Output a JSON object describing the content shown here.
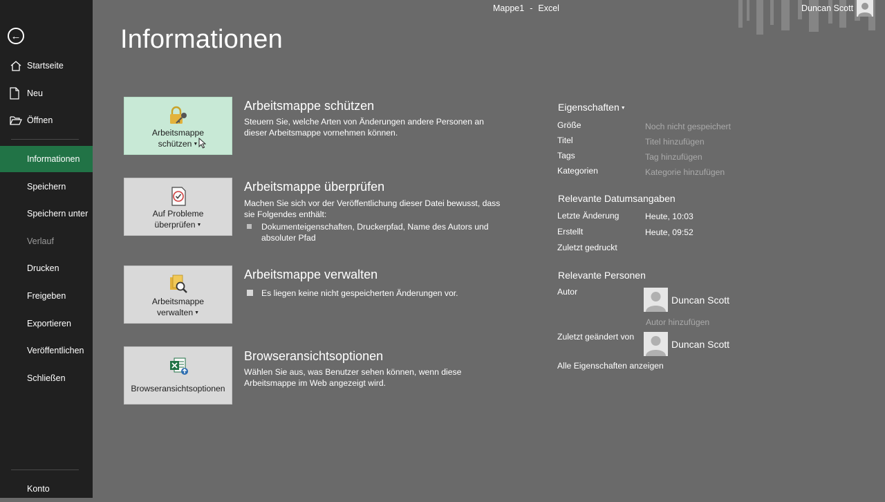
{
  "window": {
    "document": "Mappe1",
    "separator": "-",
    "app": "Excel",
    "user": "Duncan Scott"
  },
  "sidebar": {
    "items": [
      {
        "label": "Startseite",
        "icon": "home-icon"
      },
      {
        "label": "Neu",
        "icon": "new-document-icon"
      },
      {
        "label": "Öffnen",
        "icon": "folder-open-icon"
      },
      {
        "label": "Informationen",
        "active": true
      },
      {
        "label": "Speichern"
      },
      {
        "label": "Speichern unter"
      },
      {
        "label": "Verlauf",
        "disabled": true
      },
      {
        "label": "Drucken"
      },
      {
        "label": "Freigeben"
      },
      {
        "label": "Exportieren"
      },
      {
        "label": "Veröffentlichen"
      },
      {
        "label": "Schließen"
      }
    ],
    "account": "Konto"
  },
  "page": {
    "title": "Informationen"
  },
  "sections": {
    "protect": {
      "button_line1": "Arbeitsmappe",
      "button_line2": "schützen",
      "title": "Arbeitsmappe schützen",
      "desc": "Steuern Sie, welche Arten von Änderungen andere Personen an dieser Arbeitsmappe vornehmen können."
    },
    "inspect": {
      "button_line1": "Auf Probleme",
      "button_line2": "überprüfen",
      "title": "Arbeitsmappe überprüfen",
      "desc": "Machen Sie sich vor der Veröffentlichung dieser Datei bewusst, dass sie Folgendes enthält:",
      "bullet": "Dokumenteigenschaften, Druckerpfad, Name des Autors und absoluter Pfad"
    },
    "manage": {
      "button_line1": "Arbeitsmappe",
      "button_line2": "verwalten",
      "title": "Arbeitsmappe verwalten",
      "bullet": "Es liegen keine nicht gespeicherten Änderungen vor."
    },
    "browser": {
      "button_label": "Browseransichtsoptionen",
      "title": "Browseransichtsoptionen",
      "desc": "Wählen Sie aus, was Benutzer sehen können, wenn diese Arbeitsmappe im Web angezeigt wird."
    }
  },
  "properties": {
    "heading": "Eigenschaften",
    "rows": [
      {
        "label": "Größe",
        "value": "Noch nicht gespeichert"
      },
      {
        "label": "Titel",
        "value": "Titel hinzufügen"
      },
      {
        "label": "Tags",
        "value": "Tag hinzufügen"
      },
      {
        "label": "Kategorien",
        "value": "Kategorie hinzufügen"
      }
    ],
    "dates_heading": "Relevante Datumsangaben",
    "dates": [
      {
        "label": "Letzte Änderung",
        "value": "Heute, 10:03"
      },
      {
        "label": "Erstellt",
        "value": "Heute, 09:52"
      },
      {
        "label": "Zuletzt gedruckt",
        "value": ""
      }
    ],
    "people_heading": "Relevante Personen",
    "author_label": "Autor",
    "author_name": "Duncan Scott",
    "add_author": "Autor hinzufügen",
    "modified_label": "Zuletzt geändert von",
    "modified_name": "Duncan Scott",
    "show_all": "Alle Eigenschaften anzeigen"
  },
  "colors": {
    "accent": "#217346",
    "sidebar": "#202020",
    "background": "#6a6a6a"
  }
}
